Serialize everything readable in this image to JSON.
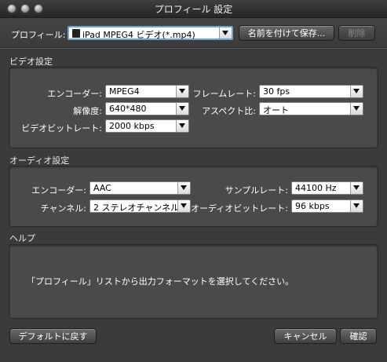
{
  "window": {
    "title": "プロフィール 設定"
  },
  "profile": {
    "label": "プロフィール:",
    "value": "iPad MPEG4 ビデオ(*.mp4)",
    "save_label": "名前を付けて保存...",
    "delete_label": "削除"
  },
  "video": {
    "section_title": "ビデオ設定",
    "encoder_label": "エンコーダー:",
    "encoder_value": "MPEG4",
    "resolution_label": "解像度:",
    "resolution_value": "640*480",
    "bitrate_label": "ビデオビットレート:",
    "bitrate_value": "2000 kbps",
    "framerate_label": "フレームレート:",
    "framerate_value": "30 fps",
    "aspect_label": "アスペクト比:",
    "aspect_value": "オート"
  },
  "audio": {
    "section_title": "オーディオ設定",
    "encoder_label": "エンコーダー:",
    "encoder_value": "AAC",
    "channel_label": "チャンネル:",
    "channel_value": "2 ステレオチャンネル",
    "samplerate_label": "サンプルレート:",
    "samplerate_value": "44100 Hz",
    "bitrate_label": "オーディオビットレート:",
    "bitrate_value": "96 kbps"
  },
  "help": {
    "section_title": "ヘルプ",
    "text": "「プロフィール」リストから出力フォーマットを選択してください。"
  },
  "footer": {
    "default_label": "デフォルトに戻す",
    "cancel_label": "キャンセル",
    "ok_label": "確認"
  }
}
